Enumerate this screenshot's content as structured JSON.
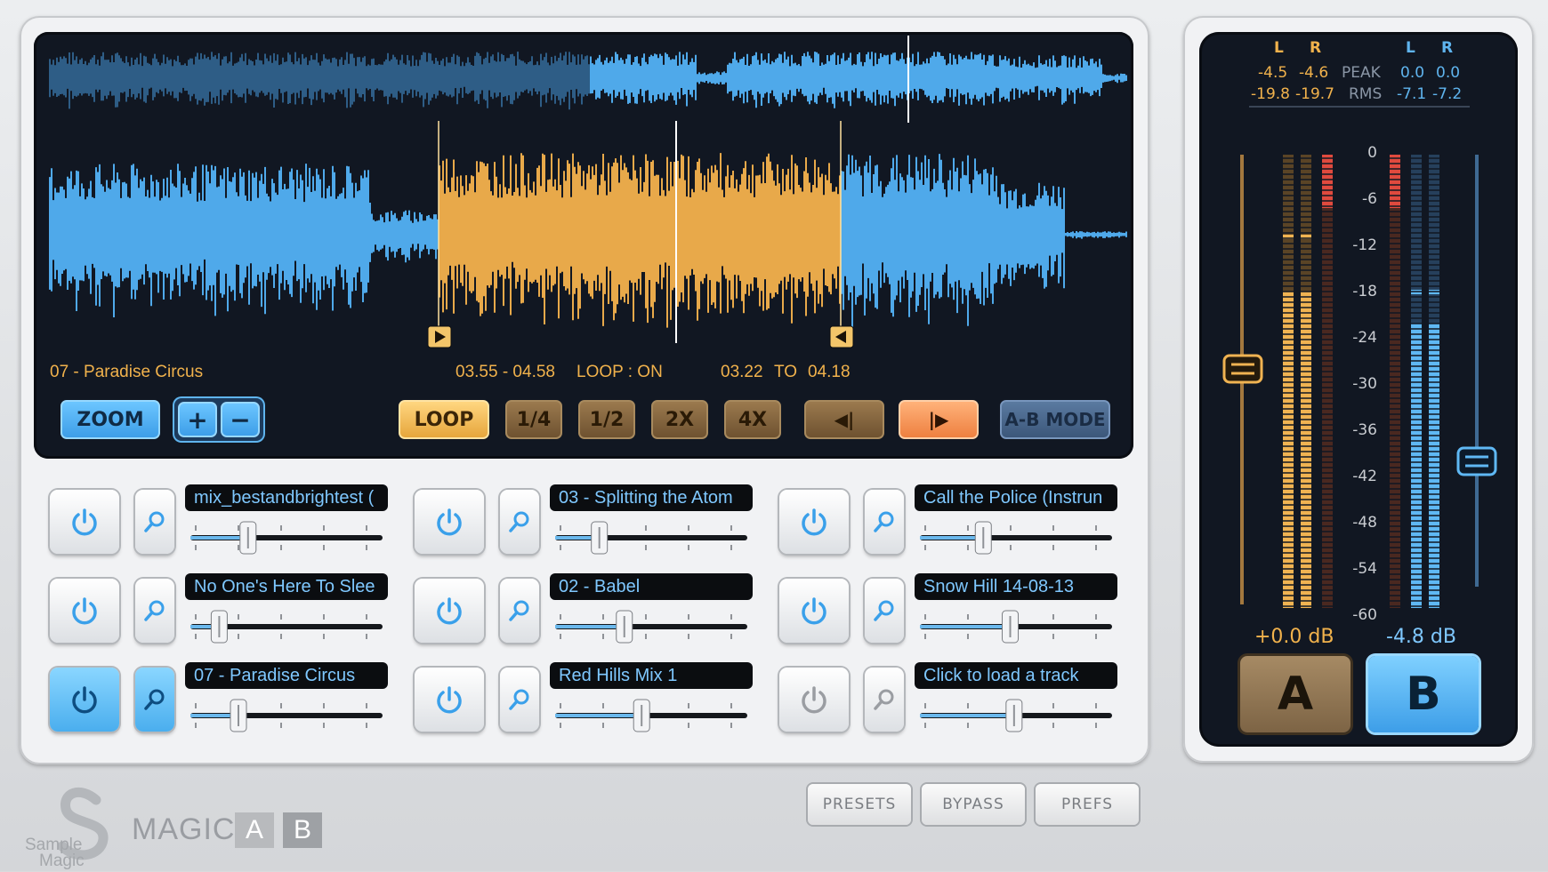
{
  "display": {
    "track_name": "07 - Paradise Circus",
    "loop_range": "03.55 - 04.58",
    "loop_state": "LOOP : ON",
    "position_from": "03.22",
    "position_to_label": "TO",
    "position_to": "04.18",
    "colors": {
      "wave_blue": "#4fa9ea",
      "wave_dark": "#2e5d86",
      "wave_gold": "#e8a94a",
      "accent": "#f1b24c"
    }
  },
  "transport": {
    "zoom": "ZOOM",
    "zoom_in": "+",
    "zoom_out": "−",
    "loop": "LOOP",
    "q": "1/4",
    "h": "1/2",
    "x2": "2X",
    "x4": "4X",
    "prev": "◀|",
    "next": "|▶",
    "ab_mode": "A-B MODE"
  },
  "slots": [
    {
      "name": "mix_bestandbrightest (",
      "active": false,
      "level": 0.3
    },
    {
      "name": "03 - Splitting the Atom",
      "active": false,
      "level": 0.23
    },
    {
      "name": "Call the Police (Instrun",
      "active": false,
      "level": 0.33
    },
    {
      "name": "No One's Here To Slee",
      "active": false,
      "level": 0.15
    },
    {
      "name": "02 - Babel",
      "active": false,
      "level": 0.36
    },
    {
      "name": "Snow Hill 14-08-13",
      "active": false,
      "level": 0.47
    },
    {
      "name": "07 - Paradise Circus",
      "active": true,
      "level": 0.25
    },
    {
      "name": "Red Hills Mix 1",
      "active": false,
      "level": 0.45
    },
    {
      "name": "Click to load a track",
      "active": false,
      "level": 0.49
    }
  ],
  "meters": {
    "ch_l": "L",
    "ch_r": "R",
    "a_peak_l": "-4.5",
    "a_peak_r": "-4.6",
    "peak_label": "PEAK",
    "b_peak_l": "0.0",
    "b_peak_r": "0.0",
    "a_rms_l": "-19.8",
    "a_rms_r": "-19.7",
    "rms_label": "RMS",
    "b_rms_l": "-7.1",
    "b_rms_r": "-7.2",
    "scale": [
      "0",
      "-6",
      "-12",
      "-18",
      "-24",
      "-30",
      "-36",
      "-42",
      "-48",
      "-54",
      "-60"
    ],
    "a_gain": "+0.0 dB",
    "b_gain": "-4.8 dB",
    "a_label": "A",
    "b_label": "B"
  },
  "footer": {
    "presets": "PRESETS",
    "bypass": "BYPASS",
    "prefs": "PREFS",
    "brand_top": "Sample",
    "brand_bottom": "Magic",
    "product": "MAGIC",
    "product_a": "A",
    "product_b": "B"
  }
}
